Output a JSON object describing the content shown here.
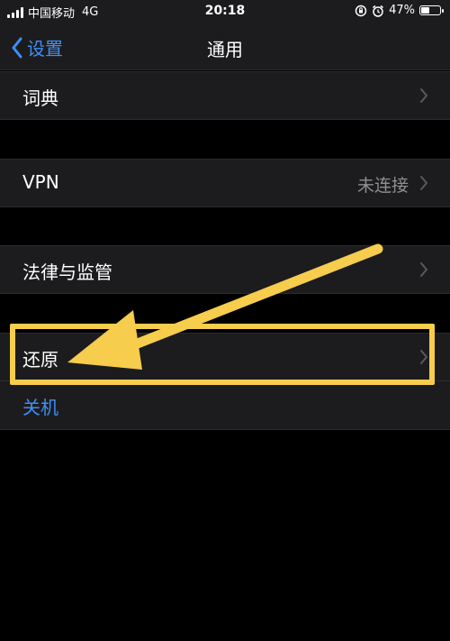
{
  "status_bar": {
    "carrier": "中国移动",
    "network": "4G",
    "time": "20:18",
    "battery": "47%",
    "battery_level": 0.47
  },
  "nav": {
    "back_label": "设置",
    "title": "通用"
  },
  "rows": {
    "dictionary": "词典",
    "vpn": "VPN",
    "vpn_status": "未连接",
    "legal": "法律与监管",
    "reset": "还原",
    "shutdown": "关机"
  },
  "colors": {
    "accent": "#3e8ff7",
    "annotation": "#f6cd4c",
    "cell_bg": "#1c1c1e"
  }
}
